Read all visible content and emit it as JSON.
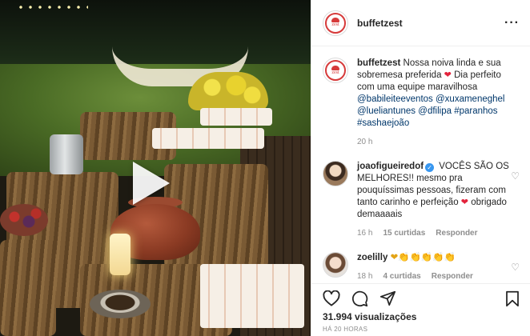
{
  "post": {
    "username": "buffetzest",
    "avatar_text": "zest",
    "more_icon": "more-horizontal-icon",
    "play_icon": "play-icon"
  },
  "caption": {
    "username": "buffetzest",
    "text_1": " Nossa noiva linda e sua sobremesa preferida ",
    "heart": "❤",
    "text_2": " Dia perfeito com uma equipe maravilhosa ",
    "mention_1": "@babileiteeventos",
    "mention_2": "@xuxameneghel",
    "mention_3": "@lueliantunes",
    "mention_4": "@dfilipa",
    "hashtag_1": "#paranhos",
    "hashtag_2": "#sashaejoão",
    "time": "20 h"
  },
  "comments": [
    {
      "username": "joaofigueiredof",
      "verified_mark": "✓",
      "text_1": " VOCÊS SÃO OS MELHORES!! mesmo pra pouquíssimas pessoas, fizeram com tanto carinho e perfeição ",
      "heart": "❤",
      "text_2": " obrigado demaaaais",
      "time": "16 h",
      "likes": "15 curtidas",
      "reply": "Responder"
    },
    {
      "username": "zoelilly",
      "text": "❤👏👏👏👏👏",
      "time": "18 h",
      "likes": "4 curtidas",
      "reply": "Responder"
    }
  ],
  "footer": {
    "views": "31.994 visualizações",
    "timestamp": "HÁ 20 HORAS"
  },
  "colors": {
    "brand_red": "#d63a3a",
    "link": "#00376b",
    "heart": "#e3233c",
    "muted": "#8e8e8e"
  }
}
